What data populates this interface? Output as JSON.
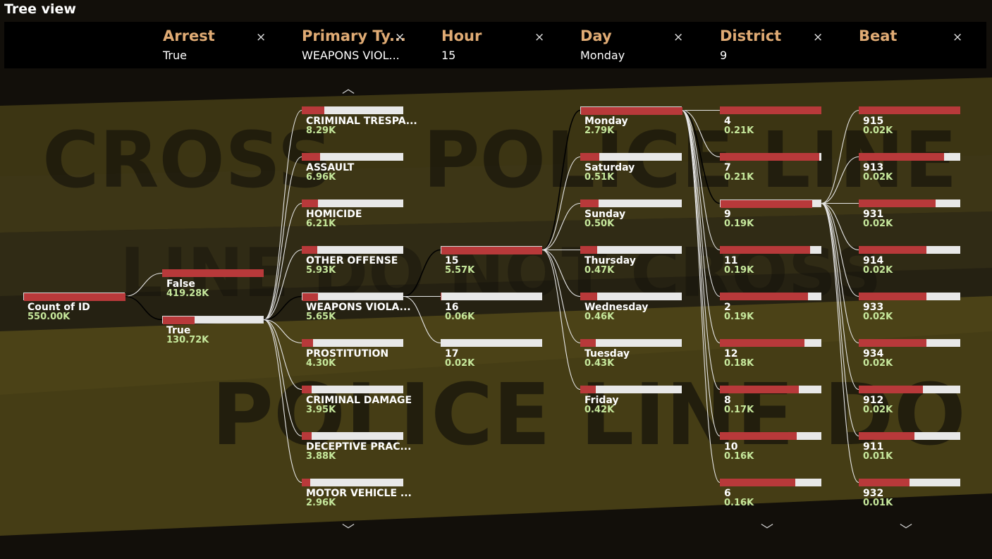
{
  "title": "Tree view",
  "filters": [
    {
      "header": "Arrest",
      "value": "True"
    },
    {
      "header": "Primary Ty...",
      "value": "WEAPONS VIOL..."
    },
    {
      "header": "Hour",
      "value": "15"
    },
    {
      "header": "Day",
      "value": "Monday"
    },
    {
      "header": "District",
      "value": "9"
    },
    {
      "header": "Beat",
      "value": ""
    }
  ],
  "close_glyph": "×",
  "chevron_up": "︿",
  "chevron_down": "﹀",
  "colors": {
    "bar_fill": "#b8393a",
    "bar_track": "#e8e8e8",
    "header": "#e0ab74",
    "value": "#c6e89c",
    "tape": "#6a5e1c"
  },
  "background_words": [
    "CROSS",
    "POLICE LINE",
    "LINE DO NOT CROSS",
    "POLICE LINE DO NOT"
  ],
  "levels": [
    {
      "name": "root",
      "selected": 0,
      "nodes": [
        {
          "label": "Count of ID",
          "value": "550.00K",
          "fill": 1.0
        }
      ]
    },
    {
      "name": "Arrest",
      "selected": 1,
      "nodes": [
        {
          "label": "False",
          "value": "419.28K",
          "fill": 1.0
        },
        {
          "label": "True",
          "value": "130.72K",
          "fill": 0.31
        }
      ]
    },
    {
      "name": "Primary Type",
      "selected": 4,
      "nodes": [
        {
          "label": "CRIMINAL TRESPA...",
          "value": "8.29K",
          "fill": 0.22
        },
        {
          "label": "ASSAULT",
          "value": "6.96K",
          "fill": 0.18
        },
        {
          "label": "HOMICIDE",
          "value": "6.21K",
          "fill": 0.16
        },
        {
          "label": "OTHER OFFENSE",
          "value": "5.93K",
          "fill": 0.15
        },
        {
          "label": "WEAPONS VIOLA...",
          "value": "5.65K",
          "fill": 0.15
        },
        {
          "label": "PROSTITUTION",
          "value": "4.30K",
          "fill": 0.11
        },
        {
          "label": "CRIMINAL DAMAGE",
          "value": "3.95K",
          "fill": 0.1
        },
        {
          "label": "DECEPTIVE PRAC...",
          "value": "3.88K",
          "fill": 0.1
        },
        {
          "label": "MOTOR VEHICLE ...",
          "value": "2.96K",
          "fill": 0.08
        }
      ]
    },
    {
      "name": "Hour",
      "selected": 0,
      "nodes": [
        {
          "label": "15",
          "value": "5.57K",
          "fill": 0.99
        },
        {
          "label": "16",
          "value": "0.06K",
          "fill": 0.01
        },
        {
          "label": "17",
          "value": "0.02K",
          "fill": 0.0
        }
      ]
    },
    {
      "name": "Day",
      "selected": 0,
      "nodes": [
        {
          "label": "Monday",
          "value": "2.79K",
          "fill": 1.0
        },
        {
          "label": "Saturday",
          "value": "0.51K",
          "fill": 0.19
        },
        {
          "label": "Sunday",
          "value": "0.50K",
          "fill": 0.18
        },
        {
          "label": "Thursday",
          "value": "0.47K",
          "fill": 0.17
        },
        {
          "label": "Wednesday",
          "value": "0.46K",
          "fill": 0.17
        },
        {
          "label": "Tuesday",
          "value": "0.43K",
          "fill": 0.15
        },
        {
          "label": "Friday",
          "value": "0.42K",
          "fill": 0.15
        }
      ]
    },
    {
      "name": "District",
      "selected": 2,
      "nodes": [
        {
          "label": "4",
          "value": "0.21K",
          "fill": 1.0
        },
        {
          "label": "7",
          "value": "0.21K",
          "fill": 0.98
        },
        {
          "label": "9",
          "value": "0.19K",
          "fill": 0.9
        },
        {
          "label": "11",
          "value": "0.19K",
          "fill": 0.89
        },
        {
          "label": "2",
          "value": "0.19K",
          "fill": 0.87
        },
        {
          "label": "12",
          "value": "0.18K",
          "fill": 0.83
        },
        {
          "label": "8",
          "value": "0.17K",
          "fill": 0.78
        },
        {
          "label": "10",
          "value": "0.16K",
          "fill": 0.76
        },
        {
          "label": "6",
          "value": "0.16K",
          "fill": 0.74
        }
      ]
    },
    {
      "name": "Beat",
      "selected": -1,
      "nodes": [
        {
          "label": "915",
          "value": "0.02K",
          "fill": 1.0
        },
        {
          "label": "913",
          "value": "0.02K",
          "fill": 0.84
        },
        {
          "label": "931",
          "value": "0.02K",
          "fill": 0.76
        },
        {
          "label": "914",
          "value": "0.02K",
          "fill": 0.67
        },
        {
          "label": "933",
          "value": "0.02K",
          "fill": 0.67
        },
        {
          "label": "934",
          "value": "0.02K",
          "fill": 0.67
        },
        {
          "label": "912",
          "value": "0.02K",
          "fill": 0.63
        },
        {
          "label": "911",
          "value": "0.01K",
          "fill": 0.55
        },
        {
          "label": "932",
          "value": "0.01K",
          "fill": 0.5
        }
      ]
    }
  ]
}
